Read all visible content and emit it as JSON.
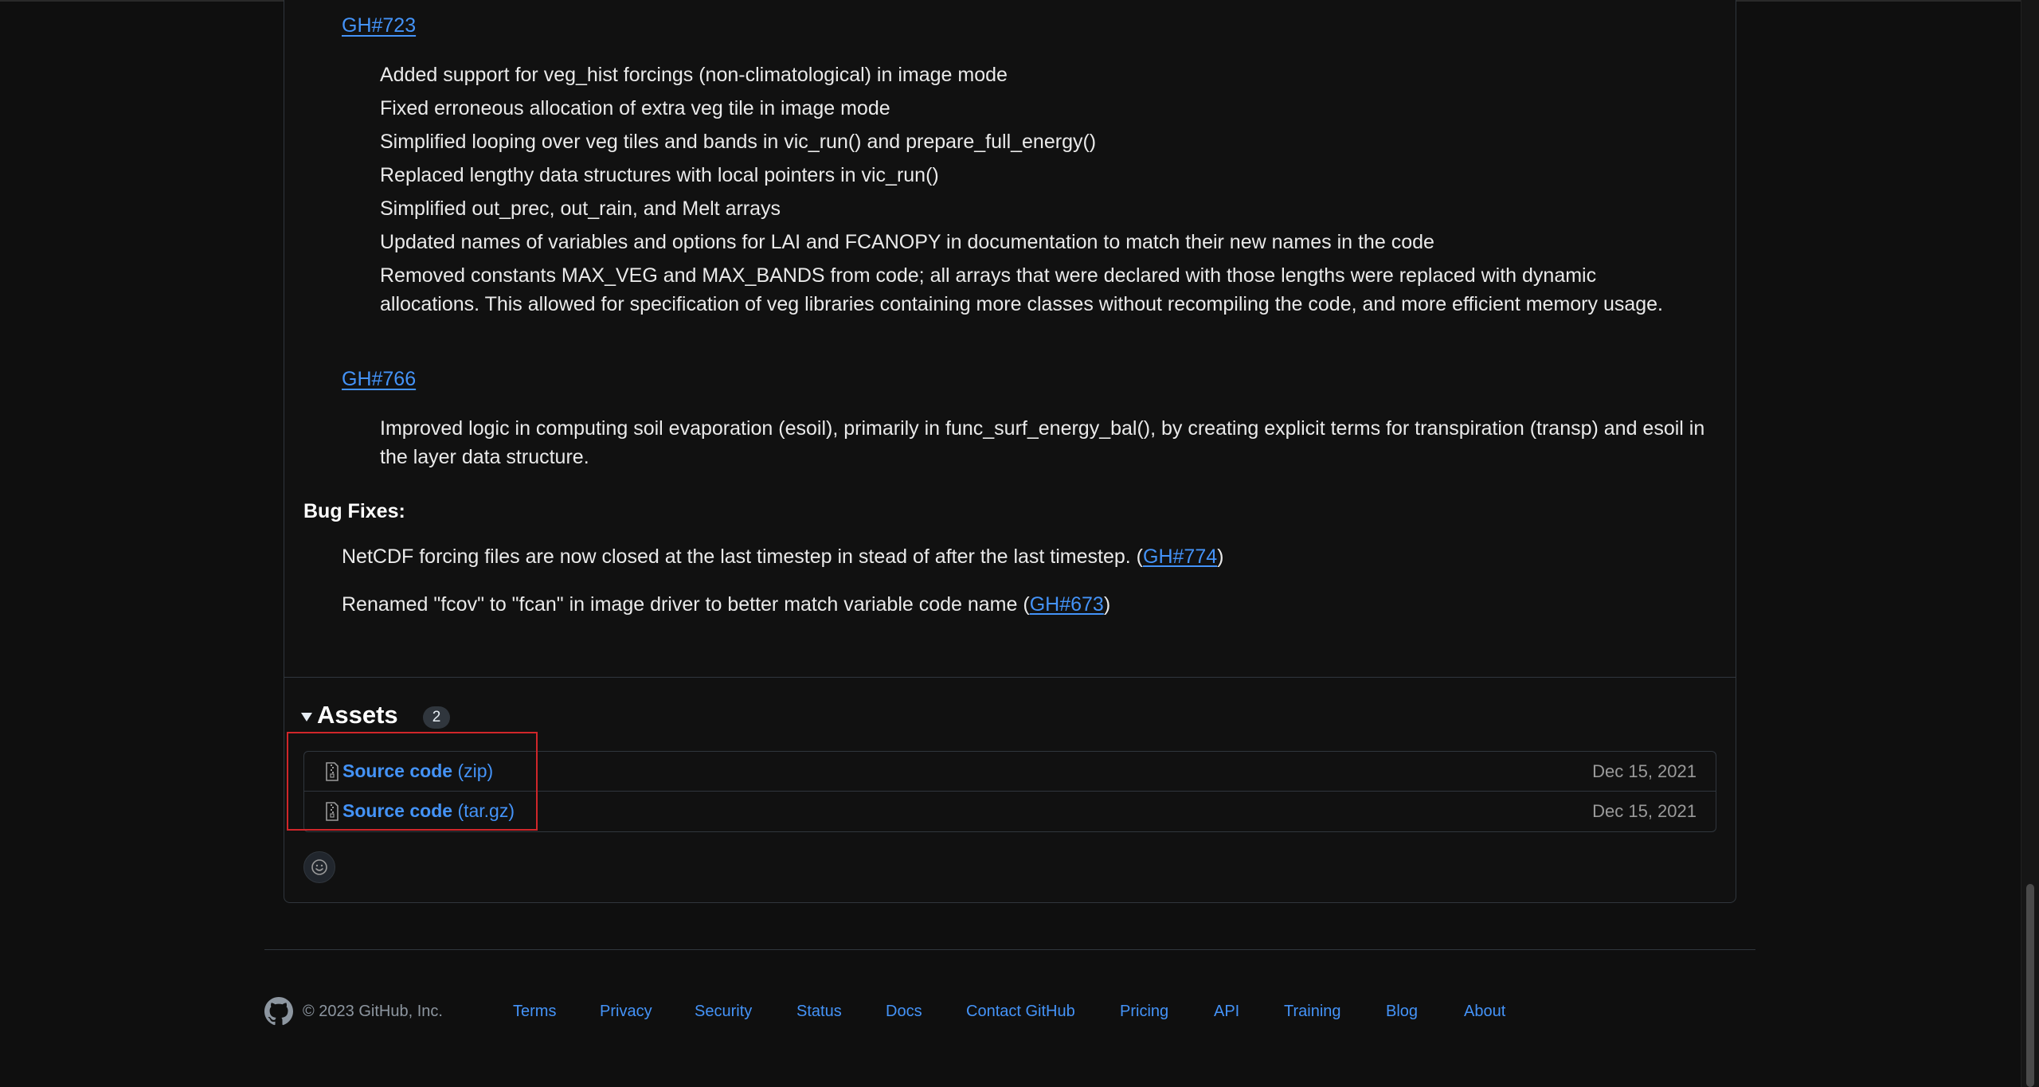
{
  "changes": {
    "gh723": {
      "ref": "GH#723",
      "items": [
        "Added support for veg_hist forcings (non-climatological) in image mode",
        "Fixed erroneous allocation of extra veg tile in image mode",
        "Simplified looping over veg tiles and bands in vic_run() and prepare_full_energy()",
        "Replaced lengthy data structures with local pointers in vic_run()",
        "Simplified out_prec, out_rain, and Melt arrays",
        "Updated names of variables and options for LAI and FCANOPY in documentation to match their new names in the code",
        "Removed constants MAX_VEG and MAX_BANDS from code; all arrays that were declared with those lengths were replaced with dynamic allocations. This allowed for specification of veg libraries containing more classes without recompiling the code, and more efficient memory usage."
      ]
    },
    "gh766": {
      "ref": "GH#766",
      "items": [
        "Improved logic in computing soil evaporation (esoil), primarily in func_surf_energy_bal(), by creating explicit terms for transpiration (transp) and esoil in the layer data structure."
      ]
    }
  },
  "bug_fixes": {
    "heading": "Bug Fixes:",
    "items": [
      {
        "text": "NetCDF forcing files are now closed at the last timestep in stead of after the last timestep. (",
        "ref": "GH#774",
        "suffix": ")"
      },
      {
        "text": "Renamed \"fcov\" to \"fcan\" in image driver to better match variable code name (",
        "ref": "GH#673",
        "suffix": ")"
      }
    ]
  },
  "assets": {
    "title": "Assets",
    "count": "2",
    "items": [
      {
        "name": "Source code",
        "ext": "(zip)",
        "date": "Dec 15, 2021"
      },
      {
        "name": "Source code",
        "ext": "(tar.gz)",
        "date": "Dec 15, 2021"
      }
    ]
  },
  "footer": {
    "copyright": "© 2023 GitHub, Inc.",
    "links": [
      "Terms",
      "Privacy",
      "Security",
      "Status",
      "Docs",
      "Contact GitHub",
      "Pricing",
      "API",
      "Training",
      "Blog",
      "About"
    ]
  },
  "colors": {
    "link": "#4493f8",
    "background": "#0f0f0f",
    "border": "#30363d",
    "highlight": "#d0262a"
  }
}
